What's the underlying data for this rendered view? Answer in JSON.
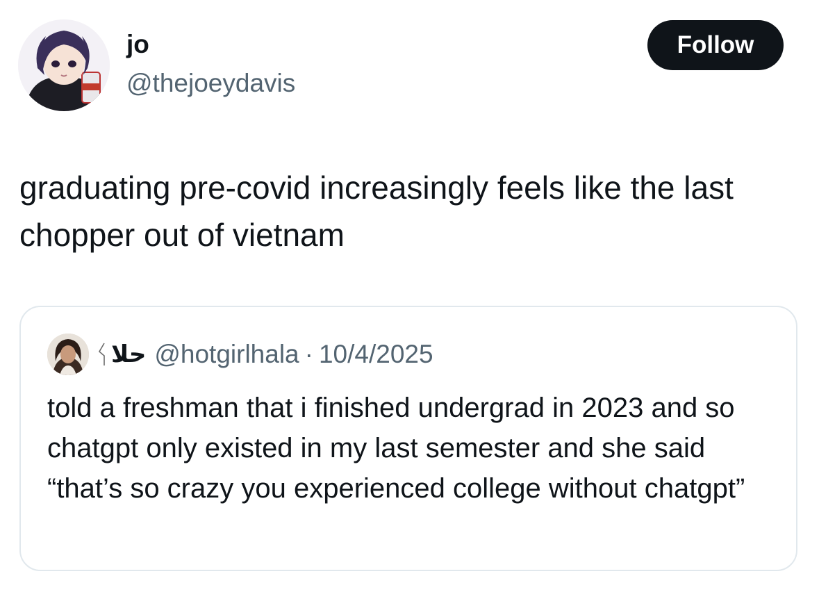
{
  "tweet": {
    "author": {
      "display_name": "jo",
      "handle": "@thejoeydavis",
      "avatar_icon": "anime-avatar-icon"
    },
    "follow_label": "Follow",
    "text": "graduating pre-covid increasingly feels like the last chopper out of vietnam"
  },
  "quoted_tweet": {
    "author": {
      "display_name": "حلا",
      "handle": "@hotgirlhala",
      "avatar_icon": "profile-photo-icon"
    },
    "separator": "·",
    "date": "10/4/2025",
    "text": "told a freshman that i finished undergrad in 2023 and so chatgpt only existed in my last semester and she said “that’s so crazy you experienced college without chatgpt”"
  },
  "colors": {
    "text_primary": "#0f1419",
    "text_secondary": "#536471",
    "button_bg": "#0f1419",
    "border": "#e1e8ed"
  }
}
